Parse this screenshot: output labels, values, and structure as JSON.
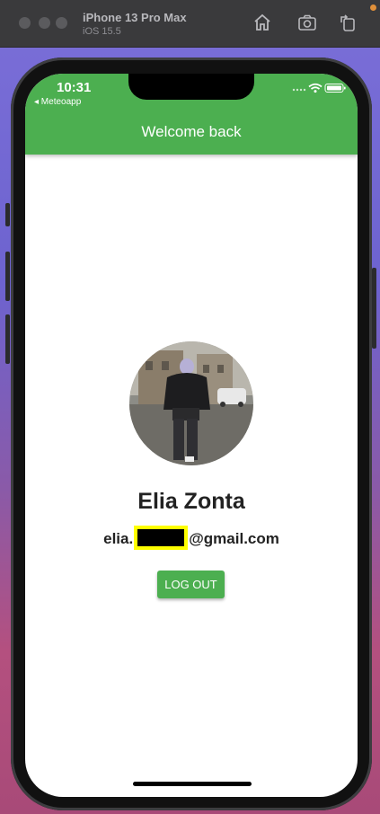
{
  "simulator": {
    "device_name": "iPhone 13 Pro Max",
    "os_version": "iOS 15.5"
  },
  "status_bar": {
    "time": "10:31",
    "back_app": "◂ Meteoapp"
  },
  "appbar": {
    "title": "Welcome back",
    "color": "#4caf50"
  },
  "profile": {
    "name": "Elia Zonta",
    "email_prefix": "elia.",
    "email_suffix": "@gmail.com"
  },
  "actions": {
    "logout_label": "LOG OUT"
  },
  "colors": {
    "accent": "#4caf50",
    "redaction_border": "#ffff00"
  }
}
